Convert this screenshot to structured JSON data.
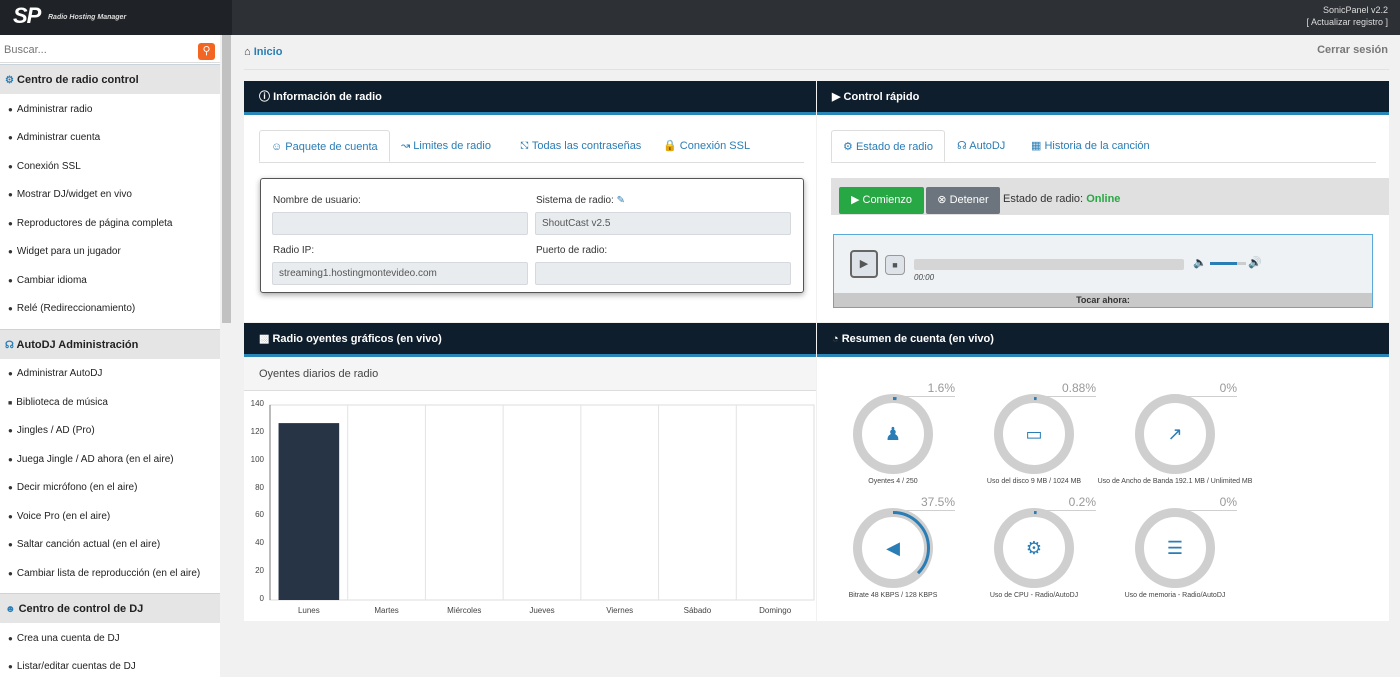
{
  "header": {
    "logo_text": "SP",
    "logo_subtitle": "Radio Hosting Manager",
    "version": "SonicPanel v2.2",
    "update_link": "[ Actualizar registro ]"
  },
  "search": {
    "placeholder": "Buscar..."
  },
  "sidebar": {
    "sections": [
      {
        "title": "Centro de radio control",
        "items": [
          "Administrar radio",
          "Administrar cuenta",
          "Conexión SSL",
          "Mostrar DJ/widget en vivo",
          "Reproductores de página completa",
          "Widget para un jugador",
          "Cambiar idioma",
          "Relé (Redireccionamiento)"
        ]
      },
      {
        "title": "AutoDJ Administración",
        "items": [
          "Administrar AutoDJ",
          "Biblioteca de música",
          "Jingles / AD (Pro)",
          "Juega Jingle / AD ahora (en el aire)",
          "Decir micrófono (en el aire)",
          "Voice Pro (en el aire)",
          "Saltar canción actual (en el aire)",
          "Cambiar lista de reproducción (en el aire)"
        ]
      },
      {
        "title": "Centro de control de DJ",
        "items": [
          "Crea una cuenta de DJ",
          "Listar/editar cuentas de DJ"
        ]
      }
    ]
  },
  "breadcrumb": "Inicio",
  "logout": "Cerrar sesión",
  "info_panel": {
    "title": "Información de radio",
    "tabs": [
      "Paquete de cuenta",
      "Limites de radio",
      "Todas las contraseñas",
      "Conexión SSL"
    ],
    "fields": {
      "username_label": "Nombre de usuario:",
      "username_value": "",
      "system_label": "Sistema de radio:",
      "system_value": "ShoutCast v2.5",
      "ip_label": "Radio IP:",
      "ip_value": "streaming1.hostingmontevideo.com",
      "port_label": "Puerto de radio:",
      "port_value": ""
    }
  },
  "quick_panel": {
    "title": "Control rápido",
    "tabs": [
      "Estado de radio",
      "AutoDJ",
      "Historia de la canción"
    ],
    "start_label": "Comienzo",
    "stop_label": "Detener",
    "status_label": "Estado de radio:",
    "status_value": "Online",
    "player_time": "00:00",
    "now_playing": "Tocar ahora:",
    "volume_level": 0.75,
    "colors": {
      "start": "#28a745",
      "stop": "#6c757d",
      "online": "#28a745"
    }
  },
  "chart_panel": {
    "title": "Radio oyentes gráficos (en vivo)",
    "subtitle": "Oyentes diarios de radio"
  },
  "chart_data": {
    "type": "bar",
    "categories": [
      "Lunes",
      "Martes",
      "Miércoles",
      "Jueves",
      "Viernes",
      "Sábado",
      "Domingo"
    ],
    "values": [
      127,
      0,
      0,
      0,
      0,
      0,
      0
    ],
    "ylim": [
      0,
      140
    ],
    "yticks": [
      "0",
      "20",
      "40",
      "60",
      "80",
      "100",
      "120",
      "140"
    ],
    "title": "Oyentes diarios de radio",
    "grid": true,
    "bar_color": "#263445"
  },
  "summary_panel": {
    "title": "Resumen de cuenta (en vivo)",
    "gauges": [
      {
        "pct_label": "1.6%",
        "value": 1.6,
        "label": "Oyentes 4 / 250",
        "icon": "users-icon"
      },
      {
        "pct_label": "0.88%",
        "value": 0.88,
        "label": "Uso del disco 9 MB / 1024 MB",
        "icon": "hdd-icon"
      },
      {
        "pct_label": "0%",
        "value": 0,
        "label": "Uso de Ancho de Banda 192.1 MB / Unlimited MB",
        "icon": "chart-icon"
      },
      {
        "pct_label": "37.5%",
        "value": 37.5,
        "label": "Bitrate 48 KBPS / 128 KBPS",
        "icon": "speaker-icon"
      },
      {
        "pct_label": "0.2%",
        "value": 0.2,
        "label": "Uso de CPU - Radio/AutoDJ",
        "icon": "cog-icon"
      },
      {
        "pct_label": "0%",
        "value": 0,
        "label": "Uso de memoria - Radio/AutoDJ",
        "icon": "server-icon"
      }
    ],
    "accent": "#2a7db5"
  }
}
